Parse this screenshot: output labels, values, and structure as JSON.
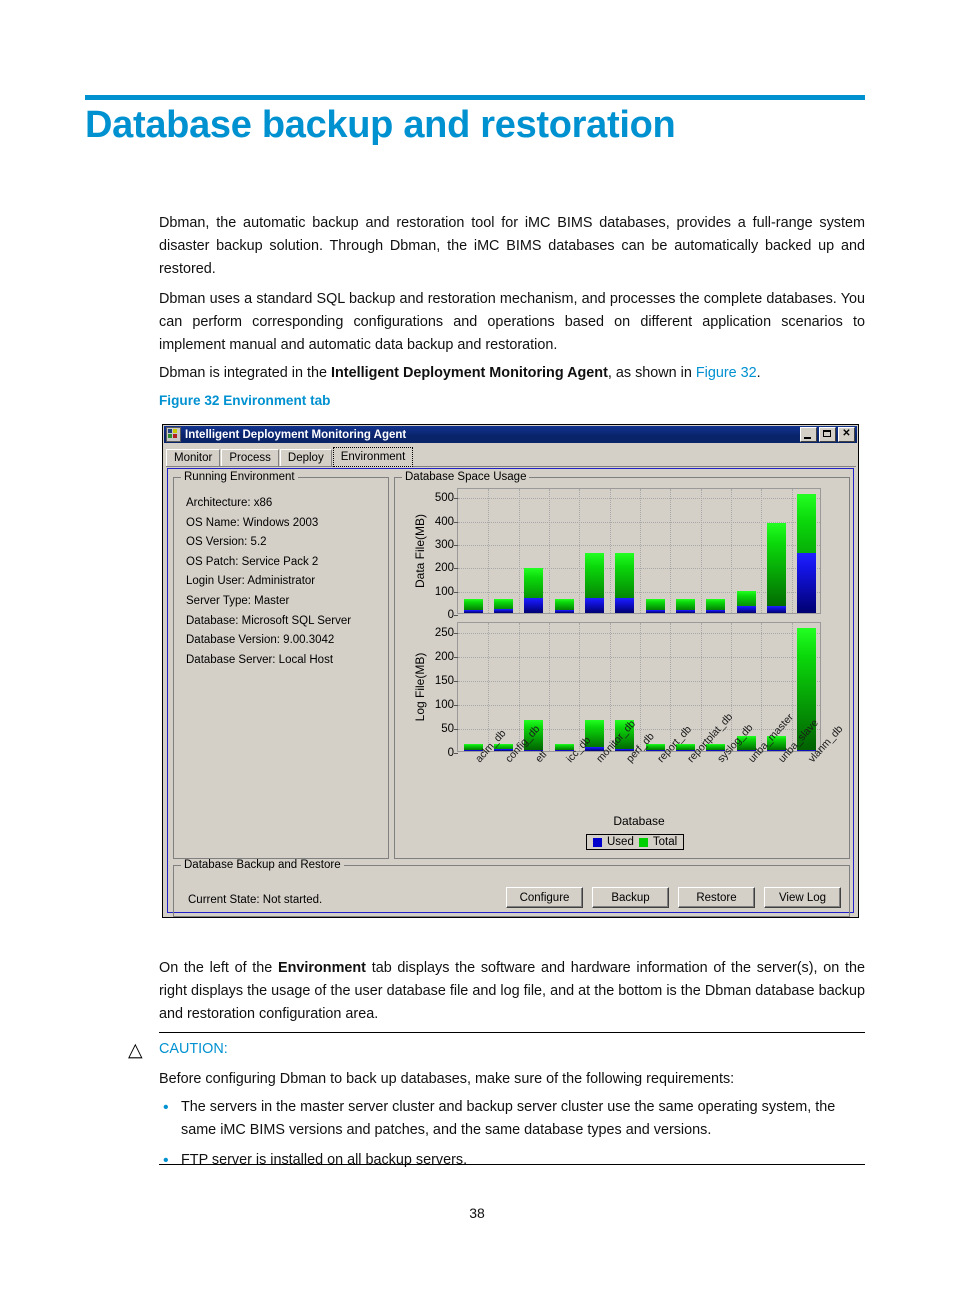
{
  "document": {
    "heading": "Database backup and restoration",
    "paragraph_1": "Dbman, the automatic backup and restoration tool for iMC BIMS databases, provides a full-range system disaster backup solution. Through Dbman, the iMC BIMS databases can be automatically backed up and restored.",
    "paragraph_2": "Dbman uses a standard SQL backup and restoration mechanism, and processes the complete databases. You can perform corresponding configurations and operations based on different application scenarios to implement manual and automatic data backup and restoration.",
    "paragraph_3_pre": "Dbman is integrated in the ",
    "paragraph_3_bold": "Intelligent Deployment Monitoring Agent",
    "paragraph_3_mid": ", as shown in ",
    "paragraph_3_link": "Figure 32",
    "paragraph_3_post": ".",
    "figure_caption": "Figure 32 Environment tab",
    "paragraph_4_pre": "On the left of the ",
    "paragraph_4_bold": "Environment",
    "paragraph_4_post": " tab displays the software and hardware information of the server(s), on the right displays the usage of the user database file and log file, and at the bottom is the Dbman database backup and restoration configuration area.",
    "caution_label": "CAUTION:",
    "caution_intro": "Before configuring Dbman to back up databases, make sure of the following requirements:",
    "caution_bullets": [
      "The servers in the master server cluster and backup server cluster use the same operating system, the same iMC BIMS versions and patches, and the same database types and versions.",
      "FTP server is installed on all backup servers."
    ],
    "page_number": "38",
    "accent_color": "#0091d0"
  },
  "window": {
    "title": "Intelligent Deployment Monitoring Agent",
    "titlebar_color": "#0a246a",
    "controls": {
      "minimize": "_",
      "maximize": "□",
      "close": "✕"
    },
    "tabs": [
      {
        "label": "Monitor",
        "active": false
      },
      {
        "label": "Process",
        "active": false
      },
      {
        "label": "Deploy",
        "active": false
      },
      {
        "label": "Environment",
        "active": true
      }
    ],
    "running_environment": {
      "title": "Running Environment",
      "items": [
        "Architecture: x86",
        "OS Name: Windows 2003",
        "OS Version: 5.2",
        "OS Patch: Service Pack 2",
        "Login User: Administrator",
        "Server Type: Master",
        "Database: Microsoft SQL Server",
        "Database Version: 9.00.3042",
        "Database Server: Local Host"
      ]
    },
    "database_space_usage": {
      "title": "Database Space Usage"
    },
    "backup_restore": {
      "title": "Database Backup and Restore",
      "current_state": "Current State: Not started.",
      "buttons": [
        "Configure",
        "Backup",
        "Restore",
        "View Log"
      ]
    }
  },
  "chart_data": [
    {
      "type": "bar",
      "title": "Database Space Usage",
      "subplot": "Data File",
      "xlabel": "Database",
      "ylabel": "Data File(MB)",
      "ylim": [
        0,
        540
      ],
      "yticks": [
        0,
        100,
        200,
        300,
        400,
        500
      ],
      "grid": true,
      "legend": [
        "Used",
        "Total"
      ],
      "legend_position": "bottom-center",
      "colors": {
        "Used": "#0000cc",
        "Total": "#00d000"
      },
      "categories": [
        "aclm_db",
        "config_db",
        "etl",
        "icc_db",
        "monitor_db",
        "perf_db",
        "report_db",
        "reportplat_db",
        "syslog_db",
        "unba_master",
        "unba_slave",
        "vlanm_db"
      ],
      "series": [
        {
          "name": "Total",
          "values": [
            62,
            62,
            192,
            62,
            256,
            256,
            62,
            62,
            62,
            96,
            384,
            512
          ]
        },
        {
          "name": "Used",
          "values": [
            14,
            16,
            64,
            14,
            64,
            64,
            12,
            12,
            12,
            28,
            28,
            256
          ]
        }
      ]
    },
    {
      "type": "bar",
      "subplot": "Log File",
      "xlabel": "Database",
      "ylabel": "Log File(MB)",
      "ylim": [
        0,
        270
      ],
      "yticks": [
        0,
        50,
        100,
        150,
        200,
        250
      ],
      "grid": true,
      "legend": [
        "Used",
        "Total"
      ],
      "legend_position": "bottom-center",
      "colors": {
        "Used": "#0000cc",
        "Total": "#00d000"
      },
      "categories": [
        "aclm_db",
        "config_db",
        "etl",
        "icc_db",
        "monitor_db",
        "perf_db",
        "report_db",
        "reportplat_db",
        "syslog_db",
        "unba_master",
        "unba_slave",
        "vlanm_db"
      ],
      "series": [
        {
          "name": "Total",
          "values": [
            15,
            15,
            64,
            15,
            64,
            64,
            15,
            15,
            15,
            32,
            32,
            256
          ]
        },
        {
          "name": "Used",
          "values": [
            1,
            4,
            2,
            1,
            8,
            5,
            1,
            1,
            1,
            3,
            3,
            2
          ]
        }
      ]
    }
  ]
}
